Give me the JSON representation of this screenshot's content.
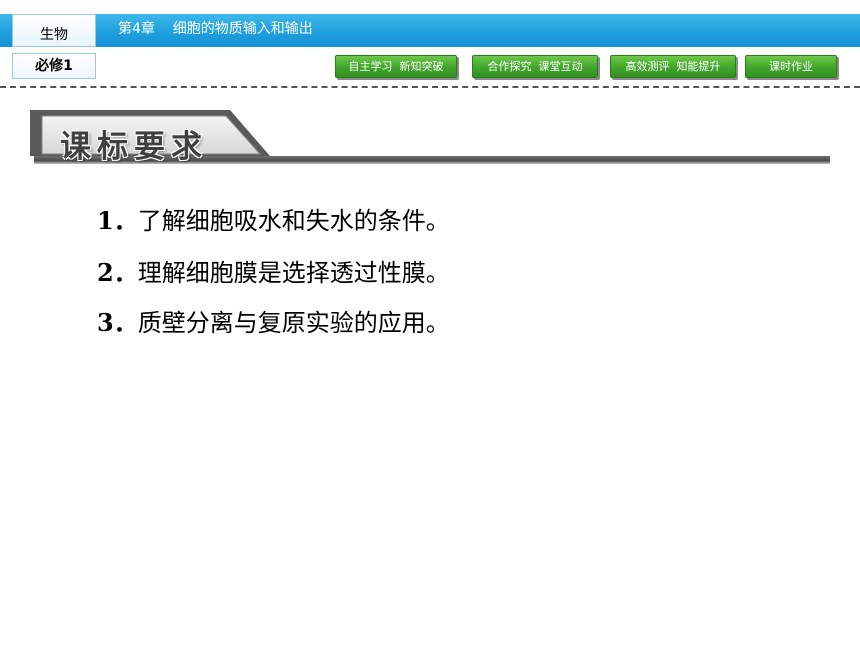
{
  "header": {
    "subject": "生物",
    "volume": "必修1",
    "chapter_title": "第4章    细胞的物质输入和输出"
  },
  "nav": {
    "btn1": "自主学习  新知突破",
    "btn2": "合作探究  课堂互动",
    "btn3": "高效测评  知能提升",
    "btn4": "课时作业"
  },
  "section": {
    "title": "课标要求"
  },
  "requirements": [
    {
      "num": "1．",
      "text": "了解细胞吸水和失水的条件。"
    },
    {
      "num": "2．",
      "text": "理解细胞膜是选择透过性膜。"
    },
    {
      "num": "3．",
      "text": "质壁分离与复原实验的应用。"
    }
  ],
  "colors": {
    "header_blue": "#1f9fde",
    "nav_green": "#42a52c",
    "banner_gray": "#555555"
  }
}
